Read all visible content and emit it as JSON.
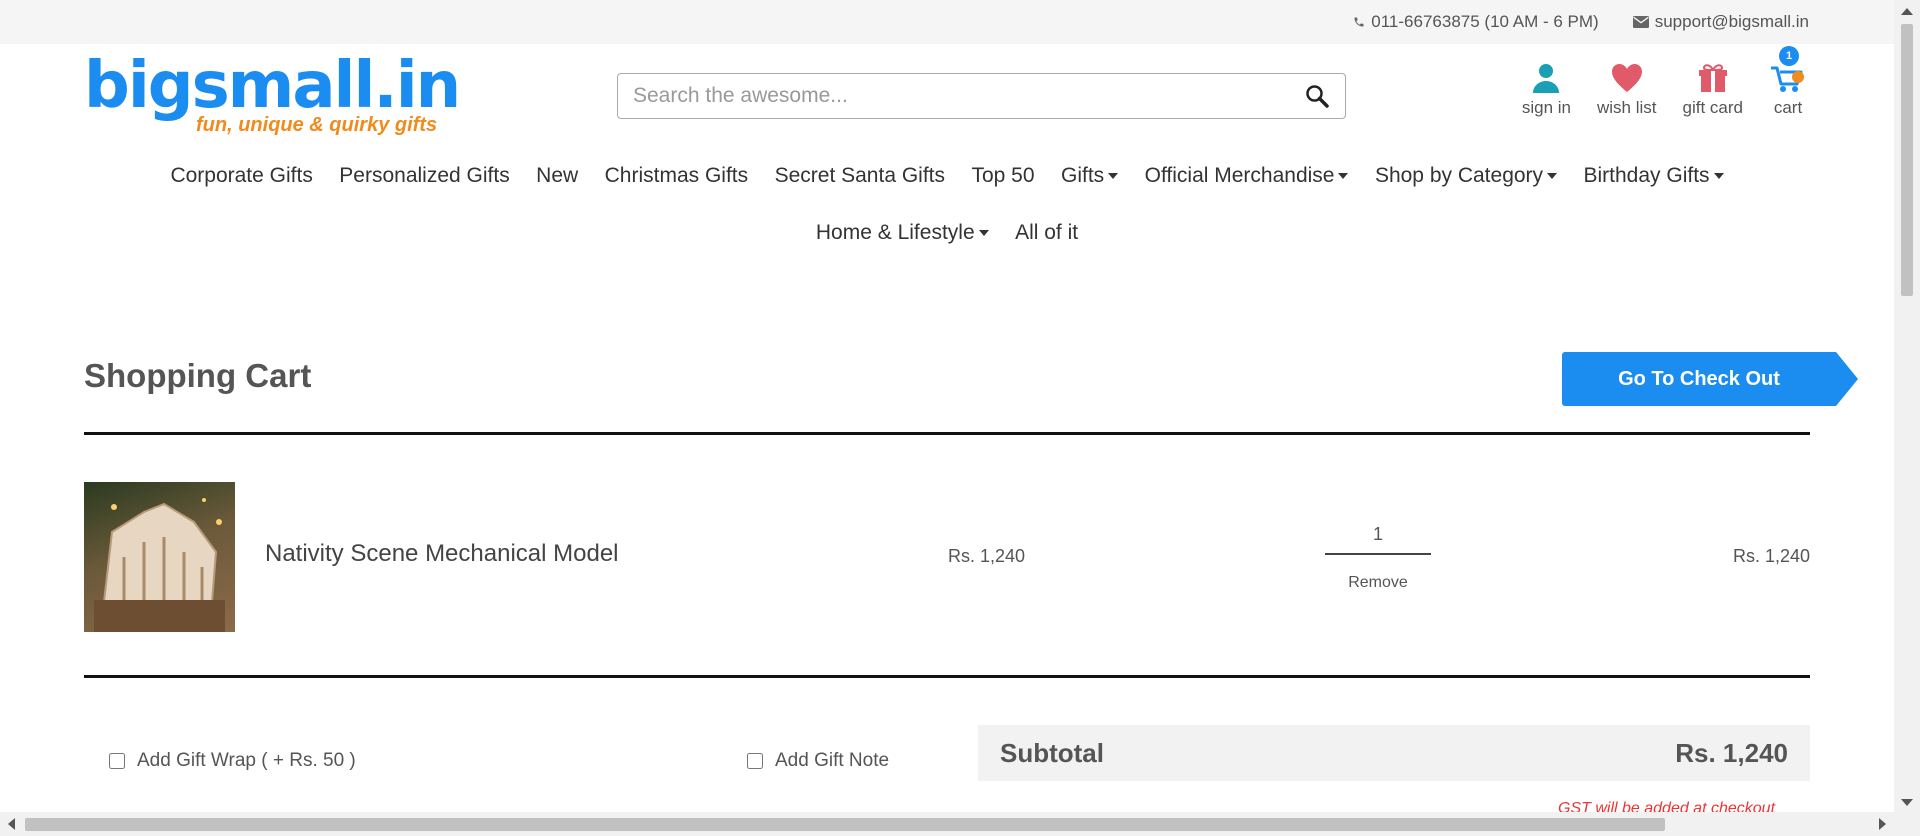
{
  "topbar": {
    "phone": "011-66763875 (10 AM - 6 PM)",
    "email": "support@bigsmall.in"
  },
  "logo": {
    "main": "bigsmall.in",
    "tagline": "fun, unique & quirky gifts"
  },
  "search": {
    "placeholder": "Search the awesome..."
  },
  "header_icons": {
    "signin": "sign in",
    "wishlist": "wish list",
    "giftcard": "gift card",
    "cart": "cart",
    "cart_count": "1"
  },
  "nav": {
    "row1": [
      {
        "label": "Corporate Gifts",
        "dropdown": false
      },
      {
        "label": "Personalized Gifts",
        "dropdown": false
      },
      {
        "label": "New",
        "dropdown": false
      },
      {
        "label": "Christmas Gifts",
        "dropdown": false
      },
      {
        "label": "Secret Santa Gifts",
        "dropdown": false
      },
      {
        "label": "Top 50",
        "dropdown": false
      },
      {
        "label": "Gifts",
        "dropdown": true
      },
      {
        "label": "Official Merchandise",
        "dropdown": true
      },
      {
        "label": "Shop by Category",
        "dropdown": true
      },
      {
        "label": "Birthday Gifts",
        "dropdown": true
      }
    ],
    "row2": [
      {
        "label": "Home & Lifestyle",
        "dropdown": true
      },
      {
        "label": "All of it",
        "dropdown": false
      }
    ]
  },
  "cart": {
    "title": "Shopping Cart",
    "checkout_label": "Go To Check Out",
    "item": {
      "name": "Nativity Scene Mechanical Model",
      "price": "Rs. 1,240",
      "quantity": "1",
      "remove_label": "Remove",
      "total": "Rs. 1,240"
    },
    "gift_wrap_label": "Add Gift Wrap ( + Rs. 50 )",
    "gift_note_label": "Add Gift Note",
    "subtotal_label": "Subtotal",
    "subtotal_value": "Rs. 1,240",
    "gst_note": "GST will be added at checkout"
  },
  "colors": {
    "brand_blue": "#1b8cf0",
    "brand_orange": "#f08b1c",
    "signin_icon": "#1a9fb5",
    "wishlist_icon": "#e05a6a",
    "giftcard_icon": "#e05a6a"
  },
  "icons": {
    "phone": "phone-icon",
    "email": "envelope-icon",
    "search": "search-icon",
    "signin": "user-icon",
    "wishlist": "heart-icon",
    "giftcard": "gift-icon",
    "cart": "cart-icon"
  }
}
